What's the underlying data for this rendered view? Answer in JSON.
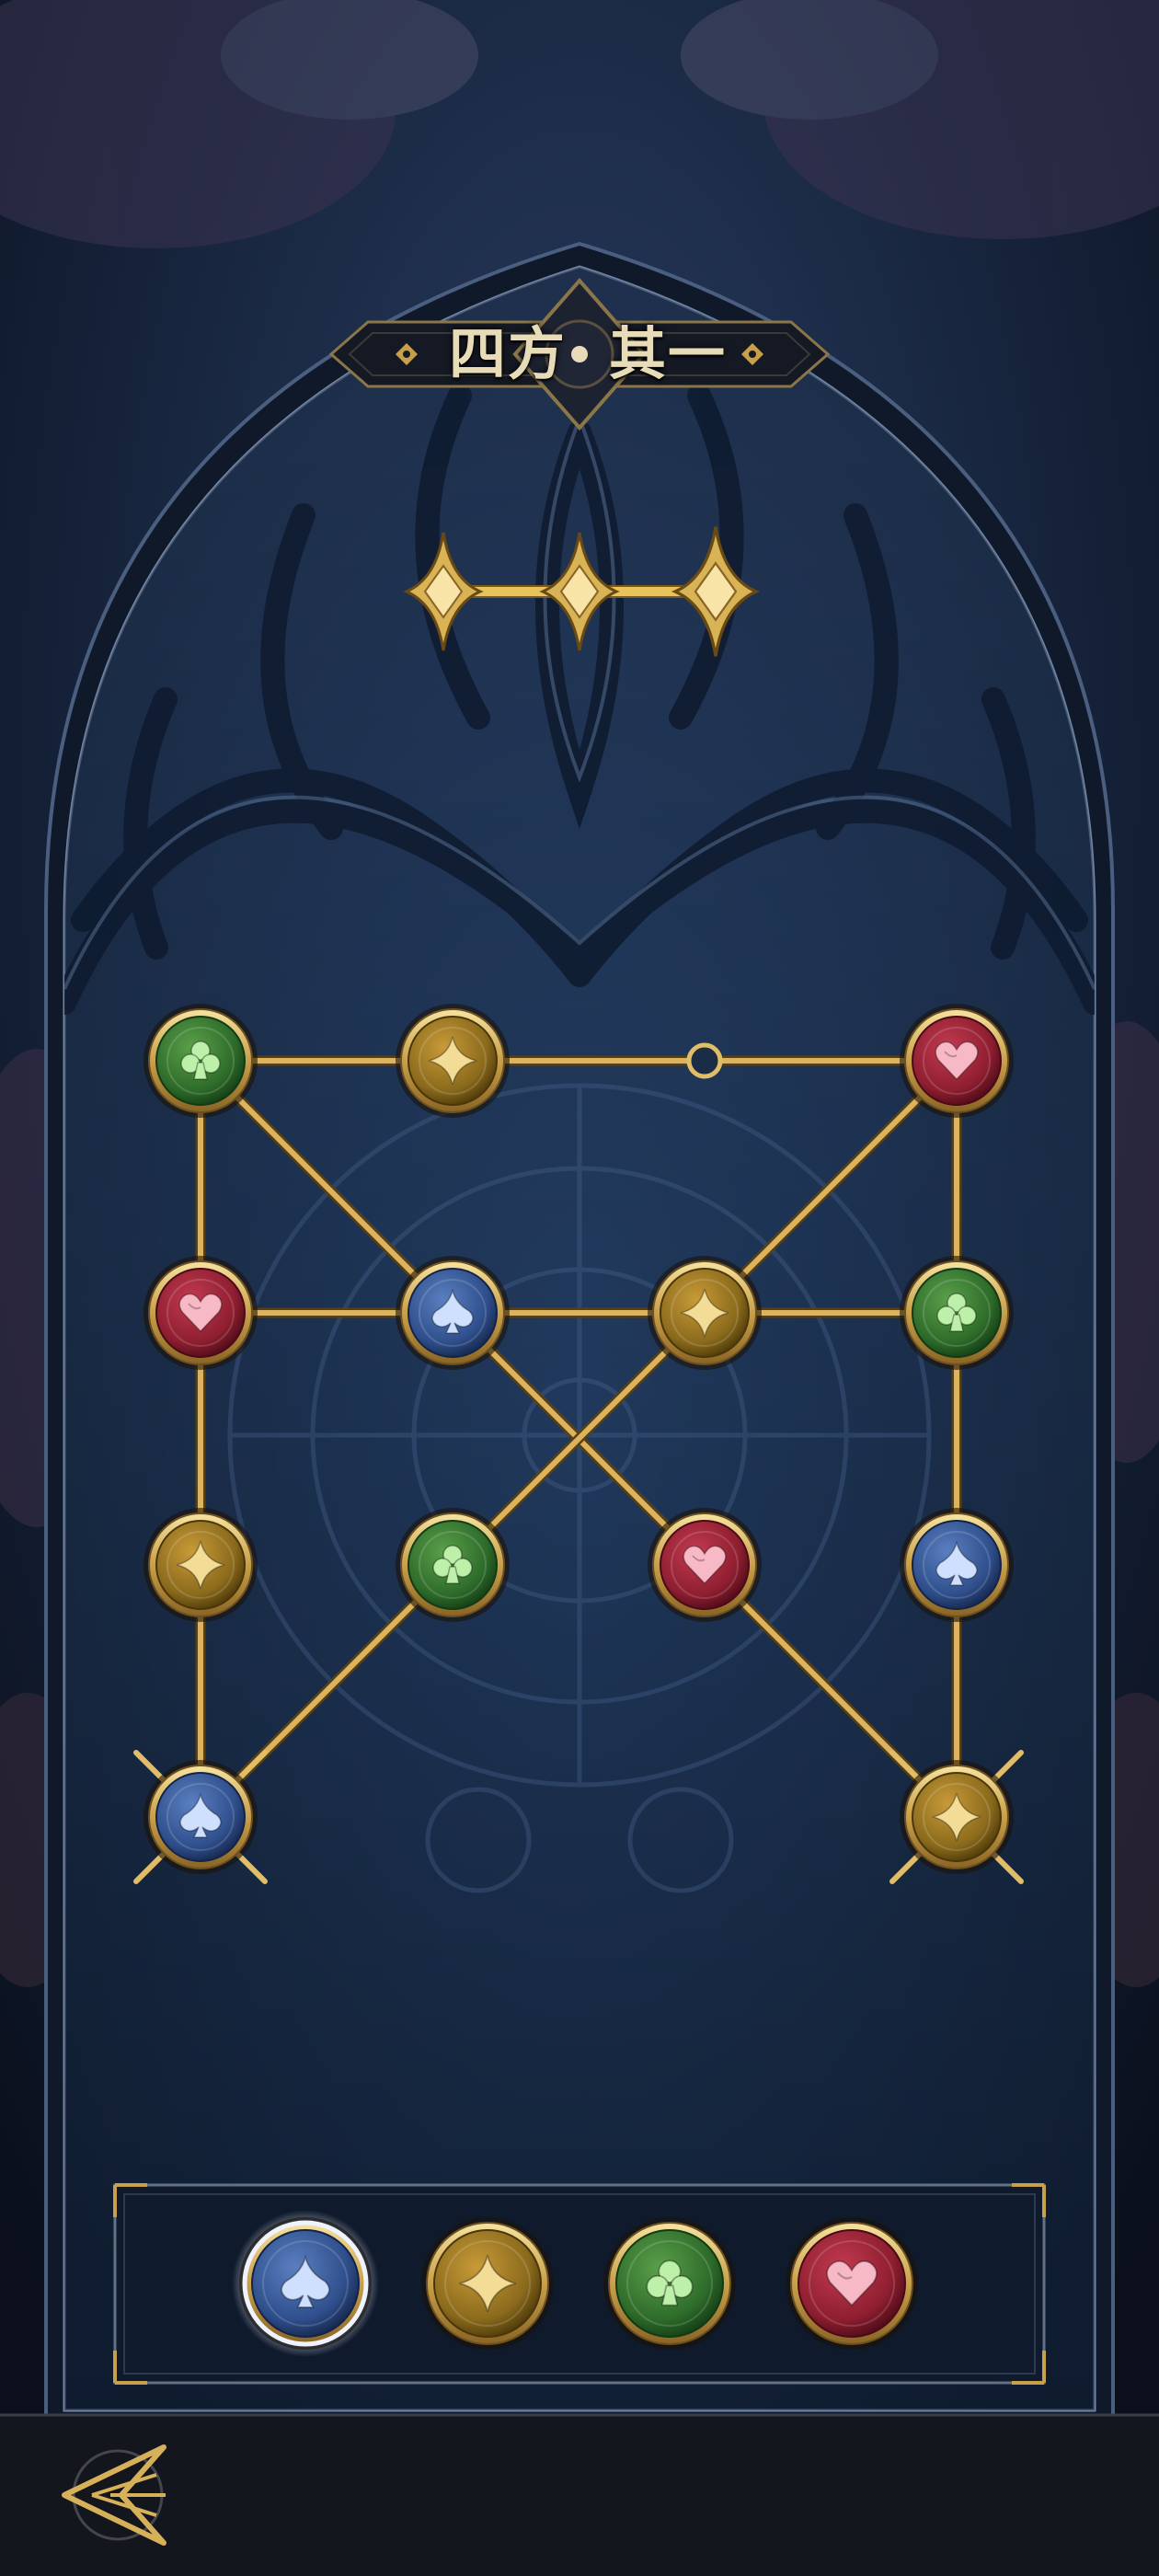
{
  "title": {
    "left": "四方",
    "right": "其一"
  },
  "progress": {
    "stars_total": 3,
    "stars_filled": 3
  },
  "puzzle": {
    "grid": {
      "columns": 4,
      "rows": 4
    },
    "nodes": [
      {
        "id": "n00",
        "col": 0,
        "row": 0,
        "suit": "club"
      },
      {
        "id": "n10",
        "col": 1,
        "row": 0,
        "suit": "diamond"
      },
      {
        "id": "n30",
        "col": 3,
        "row": 0,
        "suit": "heart"
      },
      {
        "id": "n01",
        "col": 0,
        "row": 1,
        "suit": "heart"
      },
      {
        "id": "n11",
        "col": 1,
        "row": 1,
        "suit": "spade"
      },
      {
        "id": "n21",
        "col": 2,
        "row": 1,
        "suit": "diamond"
      },
      {
        "id": "n31",
        "col": 3,
        "row": 1,
        "suit": "club"
      },
      {
        "id": "n02",
        "col": 0,
        "row": 2,
        "suit": "diamond"
      },
      {
        "id": "n12",
        "col": 1,
        "row": 2,
        "suit": "club"
      },
      {
        "id": "n22",
        "col": 2,
        "row": 2,
        "suit": "heart"
      },
      {
        "id": "n32",
        "col": 3,
        "row": 2,
        "suit": "spade"
      },
      {
        "id": "n03",
        "col": 0,
        "row": 3,
        "suit": "spade",
        "target": true
      },
      {
        "id": "n33",
        "col": 3,
        "row": 3,
        "suit": "diamond",
        "target": true
      }
    ],
    "empty_slots": [
      {
        "id": "s20",
        "col": 2,
        "row": 0
      }
    ],
    "edges": [
      [
        "n00",
        "n10"
      ],
      [
        "n10",
        "s20"
      ],
      [
        "s20",
        "n30"
      ],
      [
        "n00",
        "n01"
      ],
      [
        "n01",
        "n02"
      ],
      [
        "n02",
        "n03"
      ],
      [
        "n30",
        "n31"
      ],
      [
        "n31",
        "n32"
      ],
      [
        "n32",
        "n33"
      ],
      [
        "n01",
        "n11"
      ],
      [
        "n11",
        "n21"
      ],
      [
        "n21",
        "n31"
      ],
      [
        "n00",
        "n11"
      ],
      [
        "n11",
        "n22"
      ],
      [
        "n22",
        "n33"
      ],
      [
        "n30",
        "n21"
      ],
      [
        "n21",
        "n12"
      ],
      [
        "n12",
        "n03"
      ]
    ]
  },
  "palette": [
    {
      "suit": "spade",
      "selected": true
    },
    {
      "suit": "diamond",
      "selected": false
    },
    {
      "suit": "club",
      "selected": false
    },
    {
      "suit": "heart",
      "selected": false
    }
  ],
  "suit_colors": {
    "club": {
      "core": "#2e6b2a",
      "rim": "#123a14",
      "icon": "#bdf0a8"
    },
    "diamond": {
      "core": "#8a6a1c",
      "rim": "#4a3608",
      "icon": "#f3dc96"
    },
    "heart": {
      "core": "#8e1e30",
      "rim": "#4a0a16",
      "icon": "#f7b9c6"
    },
    "spade": {
      "core": "#2f4f8c",
      "rim": "#142448",
      "icon": "#cfe0ff"
    }
  },
  "colors": {
    "gold": "#d6b15a",
    "gold_light": "#f4dc8e",
    "frame": "#1c2d48",
    "bar": "#13161d"
  },
  "footer": {
    "back_icon": "winged-arrow-emblem-icon"
  }
}
